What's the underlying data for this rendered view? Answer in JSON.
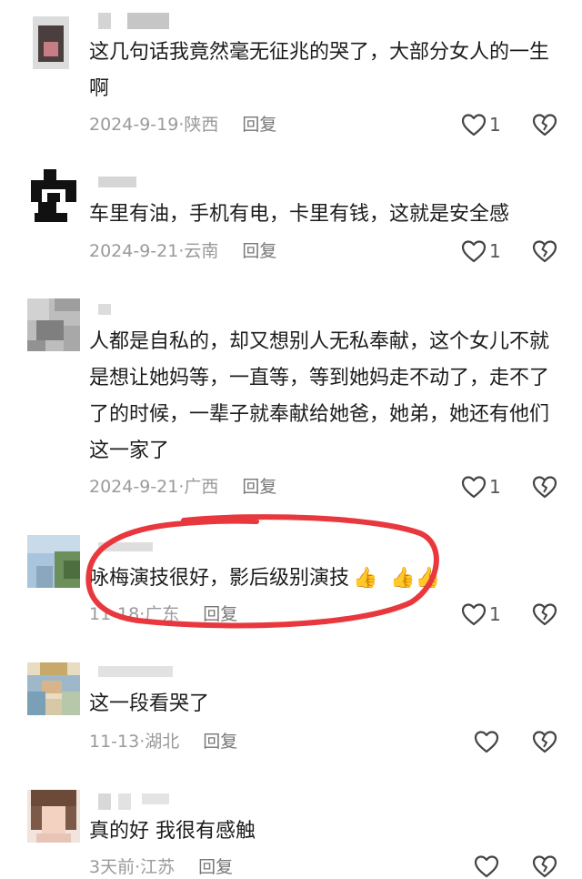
{
  "comments": [
    {
      "text": "这几句话我竟然毫无征兆的哭了，大部分女人的一生啊",
      "date": "2024-9-19",
      "region": "陕西",
      "reply": "回复",
      "likes": "1"
    },
    {
      "text": "车里有油，手机有电，卡里有钱，这就是安全感",
      "date": "2024-9-21",
      "region": "云南",
      "reply": "回复",
      "likes": "1"
    },
    {
      "text": "人都是自私的，却又想别人无私奉献，这个女儿不就是想让她妈等，一直等，等到她妈走不动了，走不了了的时候，一辈子就奉献给她爸，她弟，她还有他们这一家了",
      "date": "2024-9-21",
      "region": "广西",
      "reply": "回复",
      "likes": "1"
    },
    {
      "text": "咏梅演技很好，影后级别演技",
      "date": "11-18",
      "region": "广东",
      "reply": "回复",
      "likes": "1"
    },
    {
      "text": "这一段看哭了",
      "date": "11-13",
      "region": "湖北",
      "reply": "回复",
      "likes": ""
    },
    {
      "text": "真的好 我很有感触",
      "date": "3天前",
      "region": "江苏",
      "reply": "回复",
      "likes": ""
    }
  ],
  "separator": "·",
  "thumbs_emoji": "👍",
  "colors": {
    "text": "#1c1c1c",
    "meta": "#9a9a9a",
    "annotation": "#e8383d"
  },
  "icons": {
    "like": "heart-outline-icon",
    "dislike": "broken-heart-outline-icon"
  }
}
